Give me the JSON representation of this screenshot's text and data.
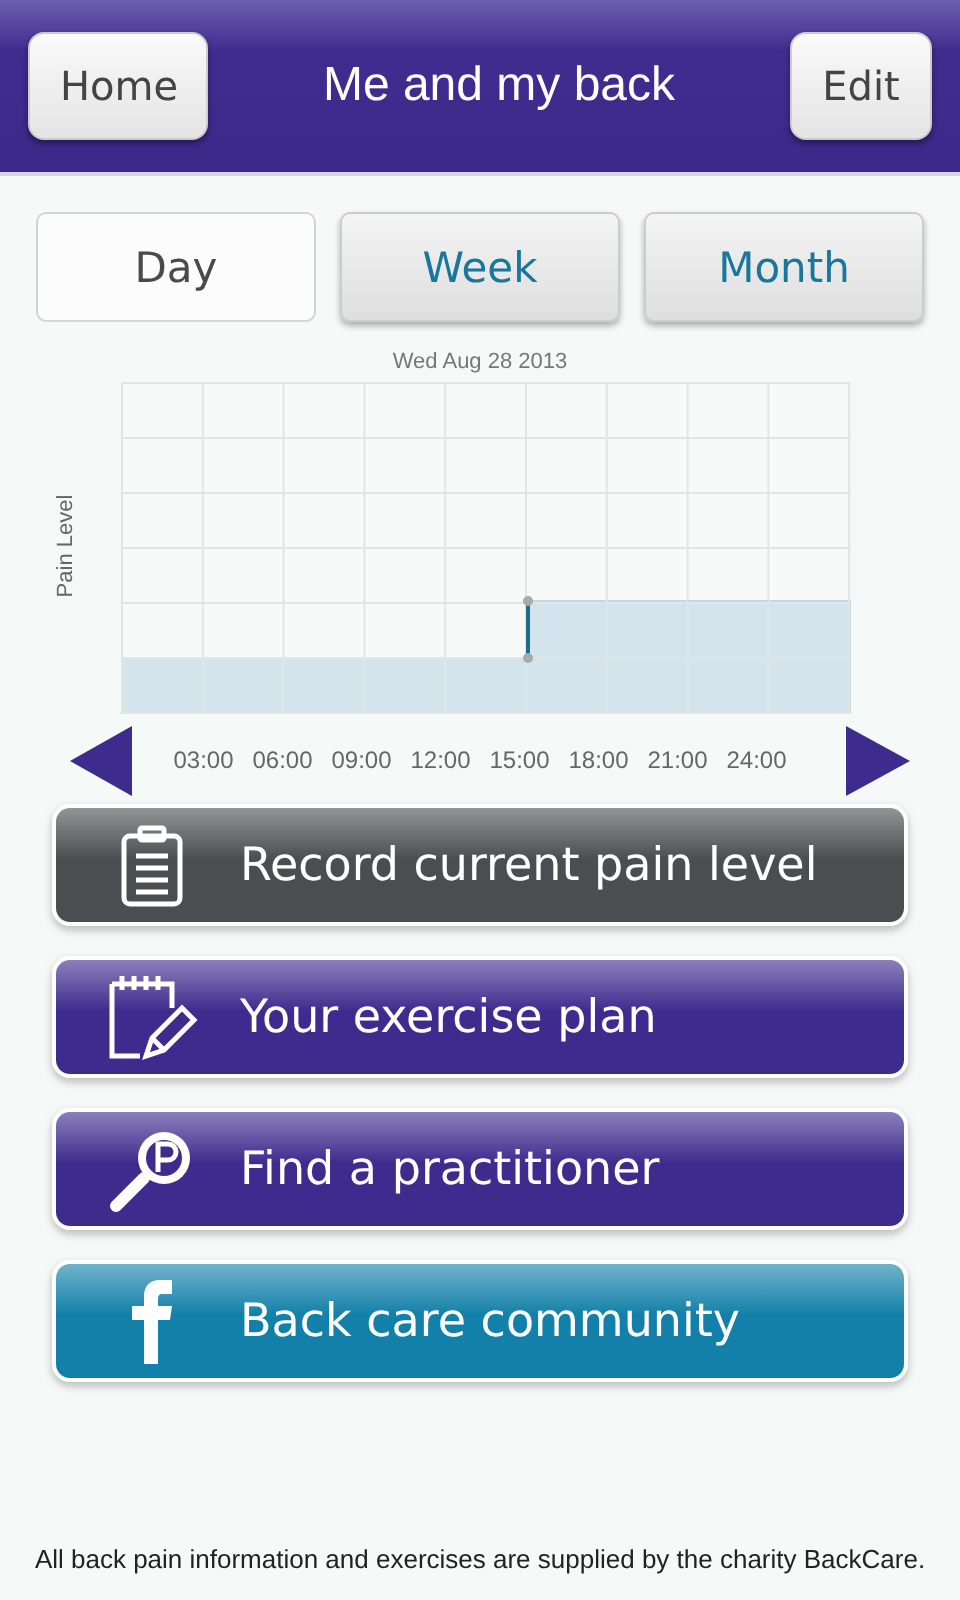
{
  "header": {
    "left_button": "Home",
    "title": "Me and my back",
    "right_button": "Edit"
  },
  "tabs": [
    {
      "label": "Day",
      "selected": true
    },
    {
      "label": "Week",
      "selected": false
    },
    {
      "label": "Month",
      "selected": false
    }
  ],
  "chart": {
    "title": "Wed Aug 28 2013",
    "ylabel": "Pain Level",
    "x_labels": [
      "03:00",
      "06:00",
      "09:00",
      "12:00",
      "15:00",
      "18:00",
      "21:00",
      "24:00"
    ]
  },
  "menu": [
    {
      "label": "Record current pain level",
      "kind": "clipboard",
      "color": "#4b4e51"
    },
    {
      "label": "Your exercise plan",
      "kind": "notepad",
      "color": "#3e2b8e"
    },
    {
      "label": "Find a practitioner",
      "kind": "finder",
      "color": "#3e2b8e"
    },
    {
      "label": "Back care community",
      "kind": "facebook",
      "color": "#1280a8"
    }
  ],
  "footer": "All back pain information and exercises are supplied by the charity BackCare."
}
